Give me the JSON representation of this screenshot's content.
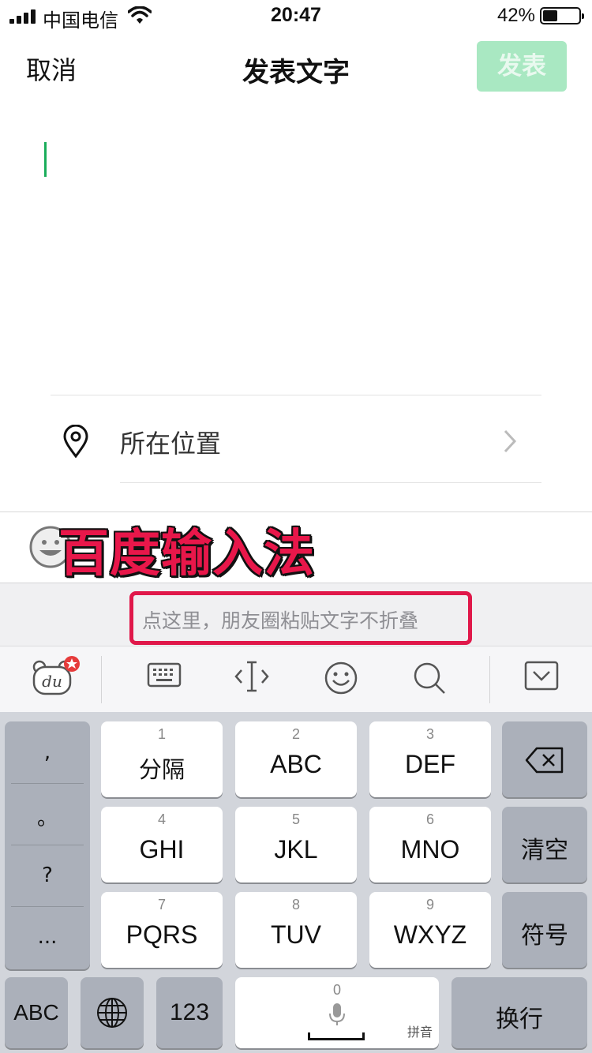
{
  "status_bar": {
    "carrier": "中国电信",
    "time": "20:47",
    "battery_percent": "42%",
    "battery_level": 0.42
  },
  "nav": {
    "cancel": "取消",
    "title": "发表文字",
    "publish": "发表"
  },
  "location": {
    "label": "所在位置"
  },
  "overlay": {
    "title": "百度输入法"
  },
  "paste_hint": "点这里，朋友圈粘贴文字不折叠",
  "keyboard": {
    "punct": [
      ",",
      "。",
      "?",
      "..."
    ],
    "keys": [
      {
        "num": "1",
        "label": "分隔"
      },
      {
        "num": "2",
        "label": "ABC"
      },
      {
        "num": "3",
        "label": "DEF"
      },
      {
        "num": "4",
        "label": "GHI"
      },
      {
        "num": "5",
        "label": "JKL"
      },
      {
        "num": "6",
        "label": "MNO"
      },
      {
        "num": "7",
        "label": "PQRS"
      },
      {
        "num": "8",
        "label": "TUV"
      },
      {
        "num": "9",
        "label": "WXYZ"
      }
    ],
    "clear": "清空",
    "symbols": "符号",
    "abc": "ABC",
    "num_mode": "123",
    "space_num": "0",
    "space_sub": "拼音",
    "newline": "换行"
  },
  "icons": {
    "brand": "baidu-du-icon",
    "tools": [
      "keyboard-icon",
      "cursor-icon",
      "emoji-icon",
      "search-icon",
      "collapse-icon"
    ],
    "delete": "backspace-icon",
    "globe": "globe-icon",
    "mic": "mic-icon"
  },
  "colors": {
    "accent": "#1aad5a",
    "publish_disabled": "#a9e8c2",
    "overlay_red": "#e8174a",
    "highlight_border": "#e0184a"
  }
}
